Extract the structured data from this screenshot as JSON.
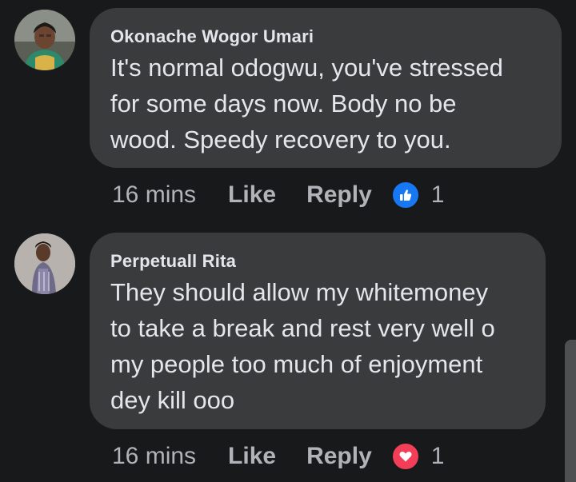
{
  "comments": [
    {
      "author": "Okonache Wogor Umari",
      "text_lines": [
        "It's normal odogwu, you've stressed",
        "for some days now. Body no be",
        "wood. Speedy recovery to you."
      ],
      "time": "16 mins",
      "like_label": "Like",
      "reply_label": "Reply",
      "reaction": {
        "icon": "like-thumb-icon",
        "color": "#1877f2",
        "count": "1"
      }
    },
    {
      "author": "Perpetuall Rita",
      "text_lines": [
        "They should allow my whitemoney",
        "to take a break and rest very well o",
        "my people too much of enjoyment",
        "dey kill ooo"
      ],
      "time": "16 mins",
      "like_label": "Like",
      "reply_label": "Reply",
      "reaction": {
        "icon": "love-heart-icon",
        "color": "#f33e58",
        "count": "1"
      }
    }
  ],
  "theme": {
    "background": "#18191a",
    "bubble": "#3a3b3c",
    "text": "#e4e6eb",
    "secondary_text": "#b0b3b8"
  }
}
